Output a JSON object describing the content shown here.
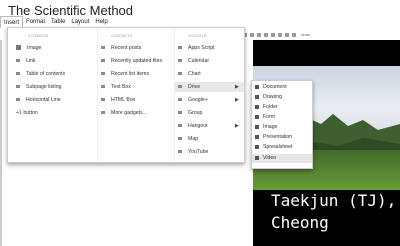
{
  "doc_title": "The Scientific Method",
  "menu": [
    "Insert",
    "Format",
    "Table",
    "Layout",
    "Help"
  ],
  "toolbar_text": "MORE",
  "columns": {
    "common": {
      "header": "COMMON",
      "items": [
        "Image",
        "Link",
        "Table of contents",
        "Subpage listing",
        "Horizontal Line",
        "+1 button"
      ]
    },
    "gadgets": {
      "header": "GADGETS",
      "items": [
        "Recent posts",
        "Recently updated files",
        "Recent list items",
        "Text Box",
        "HTML Box",
        "More gadgets..."
      ]
    },
    "google": {
      "header": "GOOGLE",
      "items": [
        "Apps Script",
        "Calendar",
        "Chart",
        "Drive",
        "Google+",
        "Group",
        "Hangout",
        "Map",
        "YouTube"
      ]
    }
  },
  "drive_submenu": [
    "Document",
    "Drawing",
    "Folder",
    "Form",
    "Image",
    "Presentation",
    "Spreadsheet",
    "Video"
  ],
  "caption": {
    "line1": "Taekjun (TJ),",
    "line2": "Cheong"
  }
}
